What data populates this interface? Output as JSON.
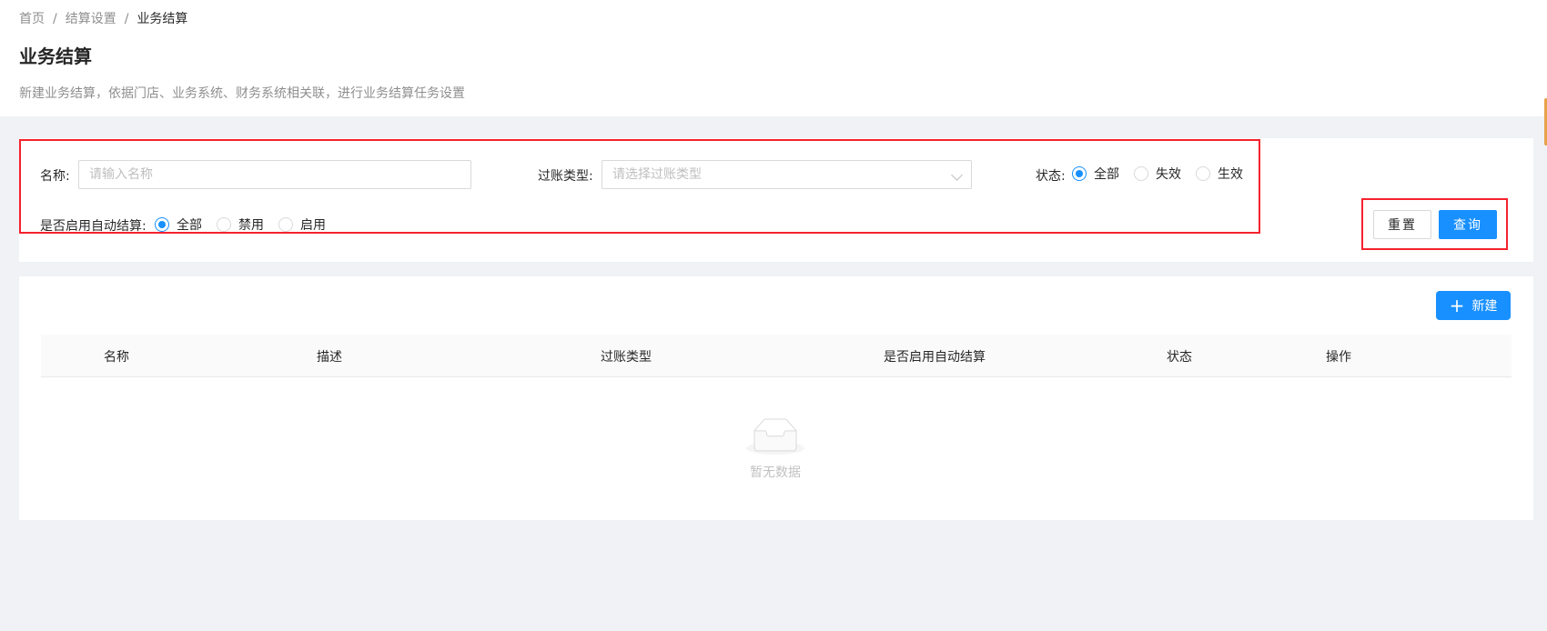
{
  "breadcrumb": {
    "items": [
      "首页",
      "结算设置",
      "业务结算"
    ],
    "separator": "/"
  },
  "page": {
    "title": "业务结算",
    "description": "新建业务结算，依据门店、业务系统、财务系统相关联，进行业务结算任务设置"
  },
  "filters": {
    "name_label": "名称:",
    "name_placeholder": "请输入名称",
    "posting_type_label": "过账类型:",
    "posting_type_placeholder": "请选择过账类型",
    "status_label": "状态:",
    "status_options": [
      "全部",
      "失效",
      "生效"
    ],
    "status_selected": "全部",
    "auto_settle_label": "是否启用自动结算:",
    "auto_settle_options": [
      "全部",
      "禁用",
      "启用"
    ],
    "auto_settle_selected": "全部"
  },
  "actions": {
    "reset_label": "重置",
    "query_label": "查询",
    "new_label": "新建"
  },
  "table": {
    "columns": [
      "名称",
      "描述",
      "过账类型",
      "是否启用自动结算",
      "状态",
      "操作"
    ],
    "rows": [],
    "empty_text": "暂无数据"
  },
  "colors": {
    "primary": "#1890ff",
    "highlight": "#f5222d",
    "background": "#f0f2f5"
  }
}
